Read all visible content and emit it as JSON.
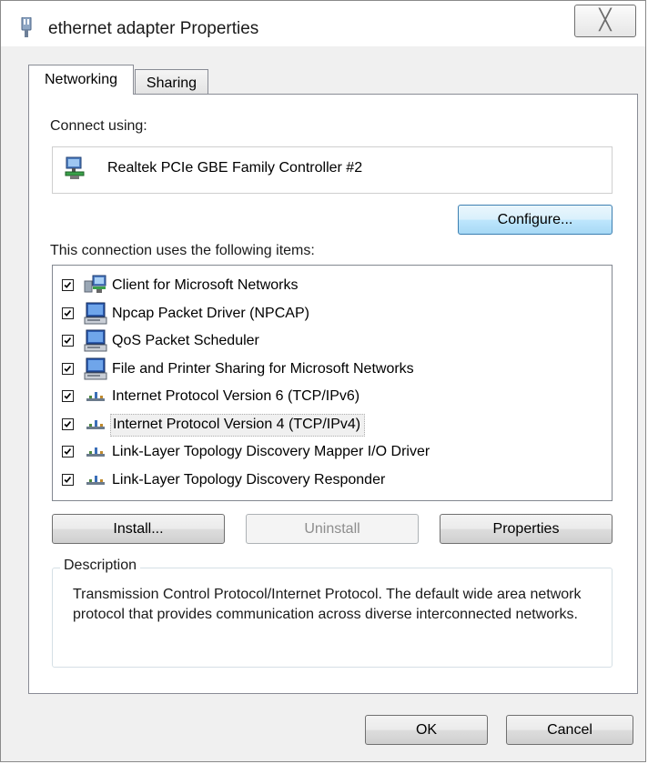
{
  "window": {
    "title": "ethernet adapter Properties",
    "close_glyph": "╳"
  },
  "tabs": [
    {
      "label": "Networking",
      "active": true
    },
    {
      "label": "Sharing",
      "active": false
    }
  ],
  "connect": {
    "label": "Connect using:",
    "adapter_name": "Realtek PCIe GBE Family Controller #2",
    "adapter_icon": "network-adapter-icon",
    "configure_label": "Configure..."
  },
  "items": {
    "label": "This connection uses the following items:",
    "list": [
      {
        "label": "Client for Microsoft Networks",
        "checked": true,
        "icon": "network-client-icon"
      },
      {
        "label": "Npcap Packet Driver (NPCAP)",
        "checked": true,
        "icon": "service-computer-icon"
      },
      {
        "label": "QoS Packet Scheduler",
        "checked": true,
        "icon": "service-computer-icon"
      },
      {
        "label": "File and Printer Sharing for Microsoft Networks",
        "checked": true,
        "icon": "service-computer-icon"
      },
      {
        "label": "Internet Protocol Version 6 (TCP/IPv6)",
        "checked": true,
        "icon": "protocol-icon"
      },
      {
        "label": "Internet Protocol Version 4 (TCP/IPv4)",
        "checked": true,
        "icon": "protocol-icon",
        "selected": true
      },
      {
        "label": "Link-Layer Topology Discovery Mapper I/O Driver",
        "checked": true,
        "icon": "protocol-icon"
      },
      {
        "label": "Link-Layer Topology Discovery Responder",
        "checked": true,
        "icon": "protocol-icon"
      }
    ]
  },
  "buttons": {
    "install": "Install...",
    "uninstall": "Uninstall",
    "properties": "Properties",
    "ok": "OK",
    "cancel": "Cancel"
  },
  "description": {
    "legend": "Description",
    "text": "Transmission Control Protocol/Internet Protocol. The default wide area network protocol that provides communication across diverse interconnected networks."
  },
  "colors": {
    "window_bg": "#f0f0f0",
    "panel_bg": "#ffffff",
    "focus_border": "#3c7fb1"
  }
}
